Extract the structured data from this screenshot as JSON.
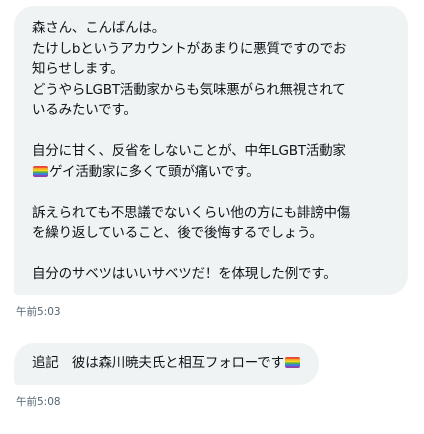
{
  "messages": [
    {
      "lines": [
        "森さん、こんばんは。",
        "たけしbというアカウントがあまりに悪質ですのでお",
        "知らせします。",
        "どうやらLGBT活動家からも気味悪がられ無視されて",
        "いるみたいです。",
        "",
        "自分に甘く、反省をしないことが、中年LGBT活動家",
        "ゲイ活動家に多くて頭が痛いです。",
        "",
        "訴えられても不思議でないくらい他の方にも誹謗中傷",
        "を繰り返していること、後で後悔するでしょう。",
        "",
        "自分のサベツはいいサベツだ！を体現した例です。"
      ],
      "timestamp": "午前5:03"
    },
    {
      "text": "追記　彼は森川暁夫氏と相互フォローです",
      "timestamp": "午前5:08"
    }
  ],
  "emoji": "rainbow-flag",
  "colors": {
    "bubble_bg": "#eff3f4",
    "text": "#0f1419",
    "timestamp": "#536471"
  }
}
